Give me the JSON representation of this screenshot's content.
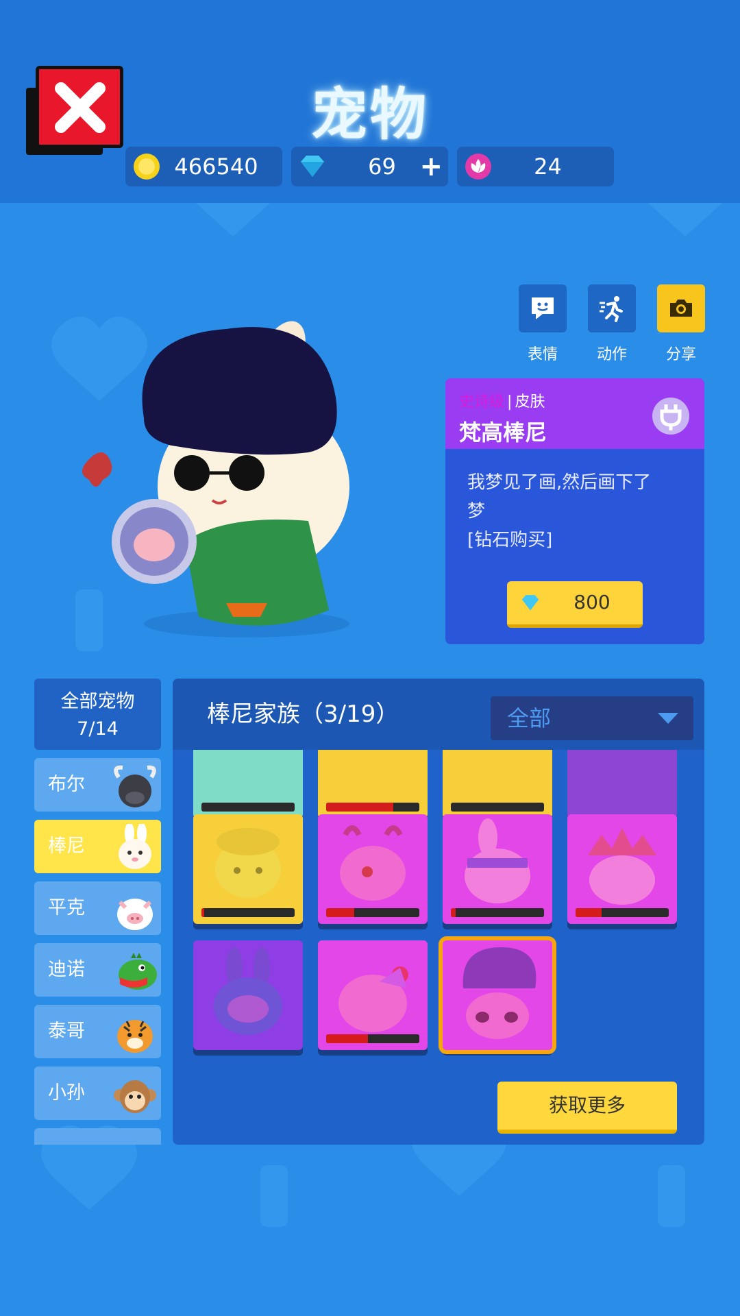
{
  "page": {
    "title": "宠物"
  },
  "currencies": {
    "coins": {
      "value": "466540",
      "icon": "gold-coin-icon"
    },
    "gems": {
      "value": "69",
      "icon": "diamond-icon",
      "add_label": "+"
    },
    "tokens": {
      "value": "24",
      "icon": "lotus-token-icon"
    }
  },
  "actions": [
    {
      "label": "表情",
      "icon": "chat-emote-icon"
    },
    {
      "label": "动作",
      "icon": "running-man-icon"
    },
    {
      "label": "分享",
      "icon": "camera-icon"
    }
  ],
  "skin": {
    "rarity": "史诗级",
    "separator": "|",
    "type": "皮肤",
    "name": "梵高棒尼",
    "description_line1": "我梦见了画,然后画下了",
    "description_line2": "梦",
    "acquire_note": "[钻石购买]",
    "price": "800",
    "price_icon": "diamond-icon"
  },
  "sidebar": {
    "all_label": "全部宠物",
    "all_count": "7/14",
    "items": [
      {
        "label": "布尔",
        "icon": "bull-icon"
      },
      {
        "label": "棒尼",
        "icon": "bunny-icon",
        "active": true
      },
      {
        "label": "平克",
        "icon": "pig-icon"
      },
      {
        "label": "迪诺",
        "icon": "dino-icon"
      },
      {
        "label": "泰哥",
        "icon": "tiger-icon"
      },
      {
        "label": "小孙",
        "icon": "monkey-icon"
      }
    ]
  },
  "grid": {
    "family_title": "棒尼家族（3/19）",
    "filter_label": "全部",
    "more_label": "获取更多"
  },
  "colors": {
    "background": "#2a8ee8",
    "accent_yellow": "#ffd43b",
    "epic_purple": "#9a3df2",
    "panel_blue": "#2a56d9"
  }
}
